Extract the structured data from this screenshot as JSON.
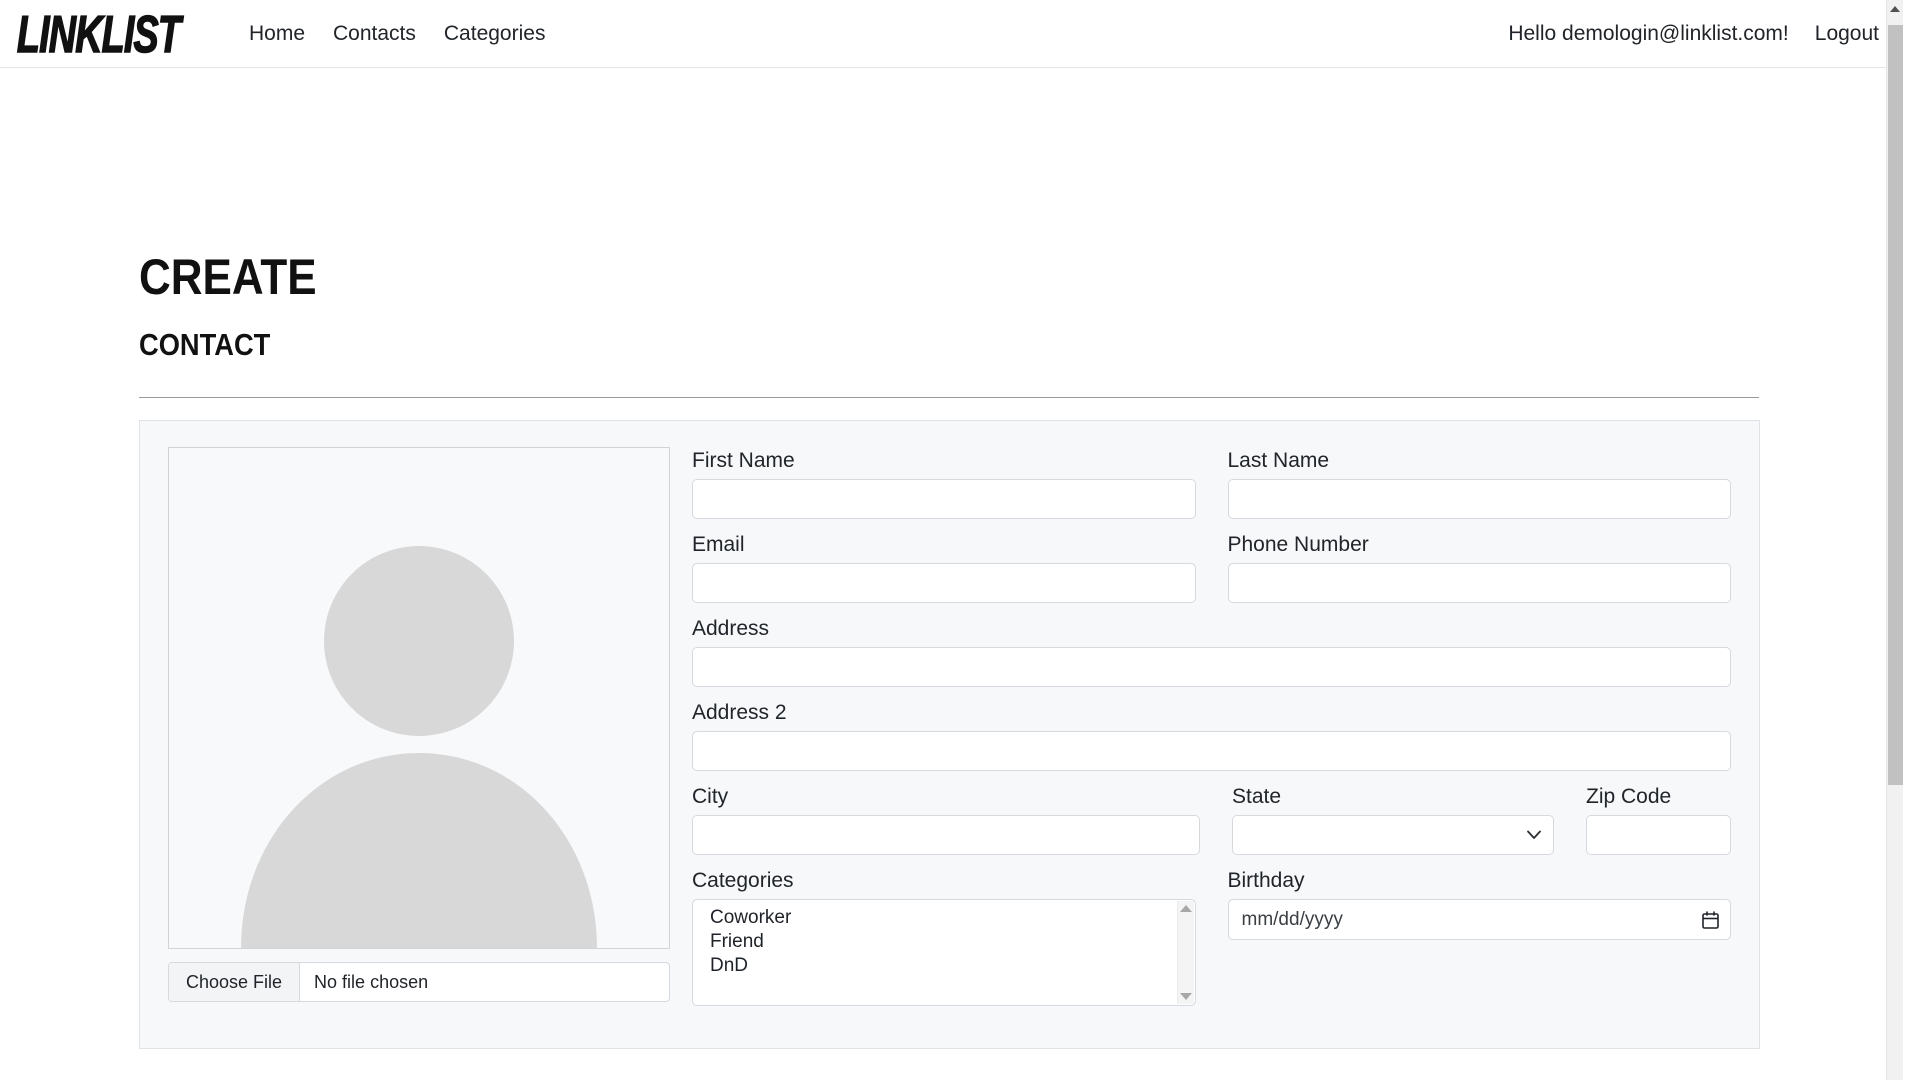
{
  "app": {
    "brand": "LINKLIST"
  },
  "nav": {
    "links": [
      {
        "label": "Home",
        "name": "nav-link-home"
      },
      {
        "label": "Contacts",
        "name": "nav-link-contacts"
      },
      {
        "label": "Categories",
        "name": "nav-link-categories"
      }
    ],
    "greeting": "Hello demologin@linklist.com!",
    "logout": "Logout"
  },
  "page": {
    "title": "CREATE",
    "subtitle": "CONTACT"
  },
  "form": {
    "photo": {
      "alt": "avatar-placeholder",
      "choose_file_label": "Choose File",
      "file_status": "No file chosen"
    },
    "fields": {
      "first_name": {
        "label": "First Name",
        "value": "",
        "placeholder": ""
      },
      "last_name": {
        "label": "Last Name",
        "value": "",
        "placeholder": ""
      },
      "email": {
        "label": "Email",
        "value": "",
        "placeholder": ""
      },
      "phone_number": {
        "label": "Phone Number",
        "value": "",
        "placeholder": ""
      },
      "address": {
        "label": "Address",
        "value": "",
        "placeholder": ""
      },
      "address2": {
        "label": "Address 2",
        "value": "",
        "placeholder": ""
      },
      "city": {
        "label": "City",
        "value": "",
        "placeholder": ""
      },
      "state": {
        "label": "State",
        "value": "",
        "placeholder": ""
      },
      "zip_code": {
        "label": "Zip Code",
        "value": "",
        "placeholder": ""
      },
      "categories": {
        "label": "Categories",
        "options": [
          "Coworker",
          "Friend",
          "DnD"
        ],
        "selected": []
      },
      "birthday": {
        "label": "Birthday",
        "value": "",
        "placeholder": "mm/dd/yyyy"
      }
    }
  },
  "colors": {
    "panel_bg": "#f6f8fa",
    "panel_border": "#dfe3e8",
    "input_border": "#d6dade",
    "text": "#212529",
    "brand": "#111111",
    "avatar_gray": "#d8d8d8",
    "scrollbar_thumb": "#c1c1c1"
  }
}
